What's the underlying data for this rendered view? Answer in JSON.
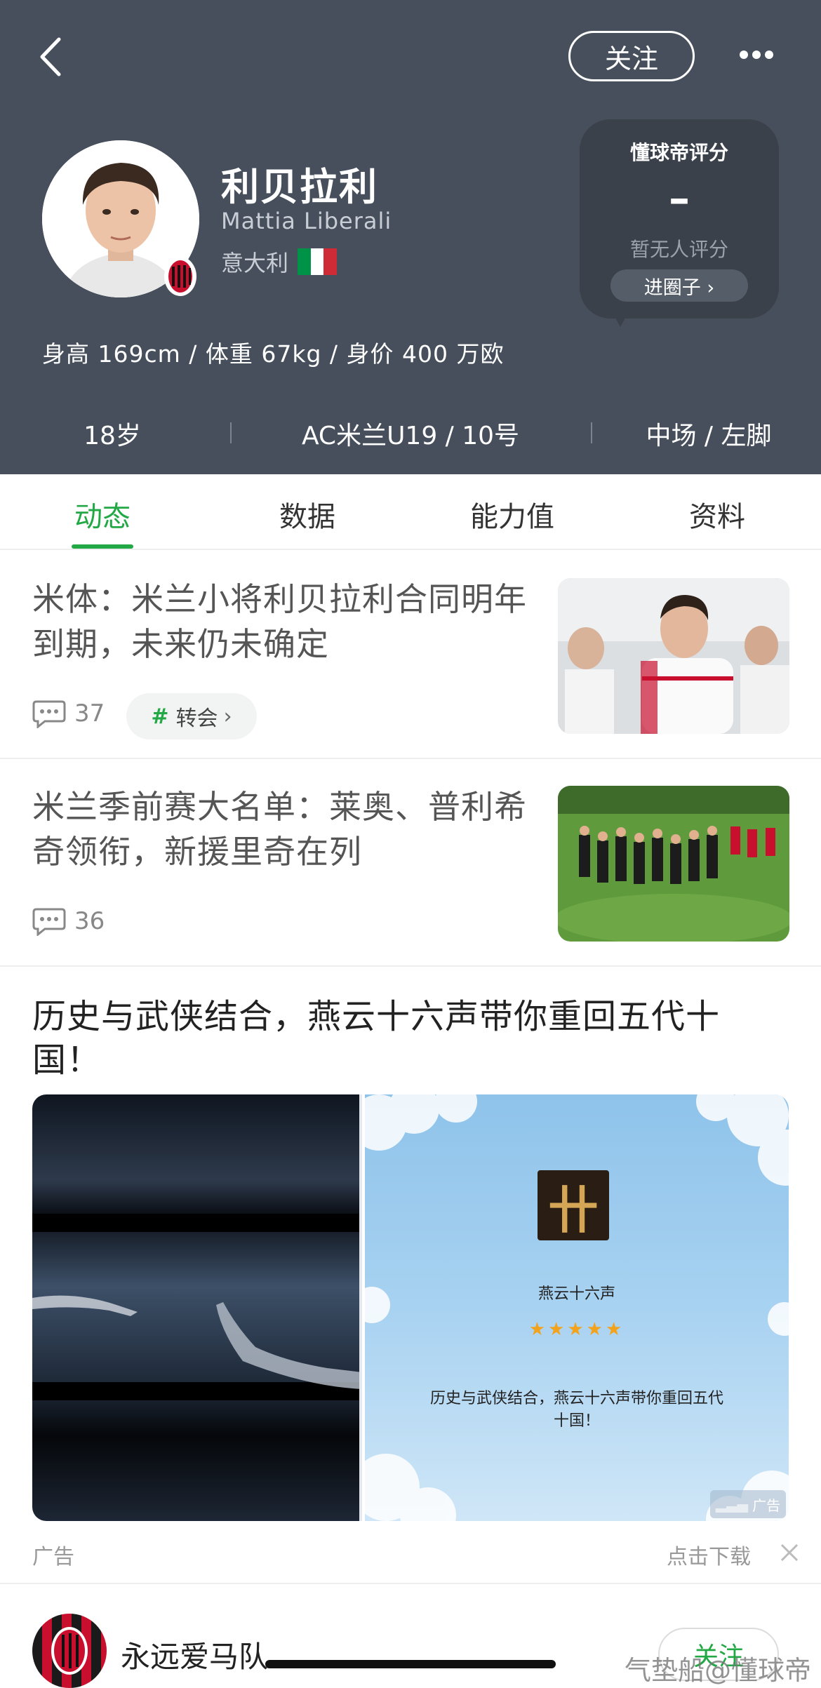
{
  "header": {
    "follow_label": "关注",
    "player": {
      "name": "利贝拉利",
      "name_en": "Mattia Liberali",
      "country": "意大利",
      "bio": "身高 169cm / 体重 67kg / 身价 400 万欧"
    },
    "rating": {
      "title": "懂球帝评分",
      "value": "–",
      "no_rating": "暂无人评分",
      "link": "进圈子 ›"
    },
    "stats": [
      "18岁",
      "AC米兰U19 / 10号",
      "中场 / 左脚"
    ],
    "flag_colors": [
      "#009246",
      "#ffffff",
      "#ce2b37"
    ]
  },
  "tabs": [
    {
      "label": "动态",
      "active": true
    },
    {
      "label": "数据",
      "active": false
    },
    {
      "label": "能力值",
      "active": false
    },
    {
      "label": "资料",
      "active": false
    }
  ],
  "news": [
    {
      "title": "米体：米兰小将利贝拉利合同明年到期，未来仍未确定",
      "comments": "37",
      "tag": "转会"
    },
    {
      "title": "米兰季前赛大名单：莱奥、普利希奇领衔，新援里奇在列",
      "comments": "36"
    }
  ],
  "ad": {
    "title": "历史与武侠结合，燕云十六声带你重回五代十国！",
    "logo_text": "卄",
    "game_name": "燕云十六声",
    "stars": "★★★★★",
    "description": "历史与武侠结合，燕云十六声带你重回五代十国！",
    "badge": "广告",
    "label": "广告",
    "download": "点击下载"
  },
  "user_row": {
    "name": "永远爱马队",
    "follow_label": "关注"
  },
  "watermark": "气垫船@懂球帝",
  "colors": {
    "header_bg": "#464f5b",
    "accent_green": "#22a845",
    "milan_red": "#c8102e"
  }
}
